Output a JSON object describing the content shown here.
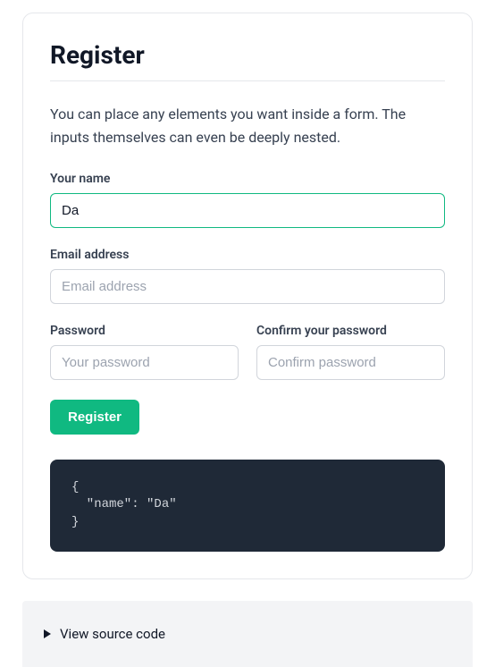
{
  "form": {
    "title": "Register",
    "description": "You can place any elements you want inside a form. The inputs themselves can even be deeply nested.",
    "fields": {
      "name": {
        "label": "Your name",
        "value": "Da",
        "placeholder": ""
      },
      "email": {
        "label": "Email address",
        "value": "",
        "placeholder": "Email address"
      },
      "password": {
        "label": "Password",
        "value": "",
        "placeholder": "Your password"
      },
      "confirm": {
        "label": "Confirm your password",
        "value": "",
        "placeholder": "Confirm password"
      }
    },
    "submit_label": "Register"
  },
  "code_output": "{\n  \"name\": \"Da\"\n}",
  "source_panel": {
    "label": "View source code"
  },
  "colors": {
    "accent": "#10b981",
    "code_bg": "#1f2937",
    "panel_bg": "#f3f4f6"
  }
}
